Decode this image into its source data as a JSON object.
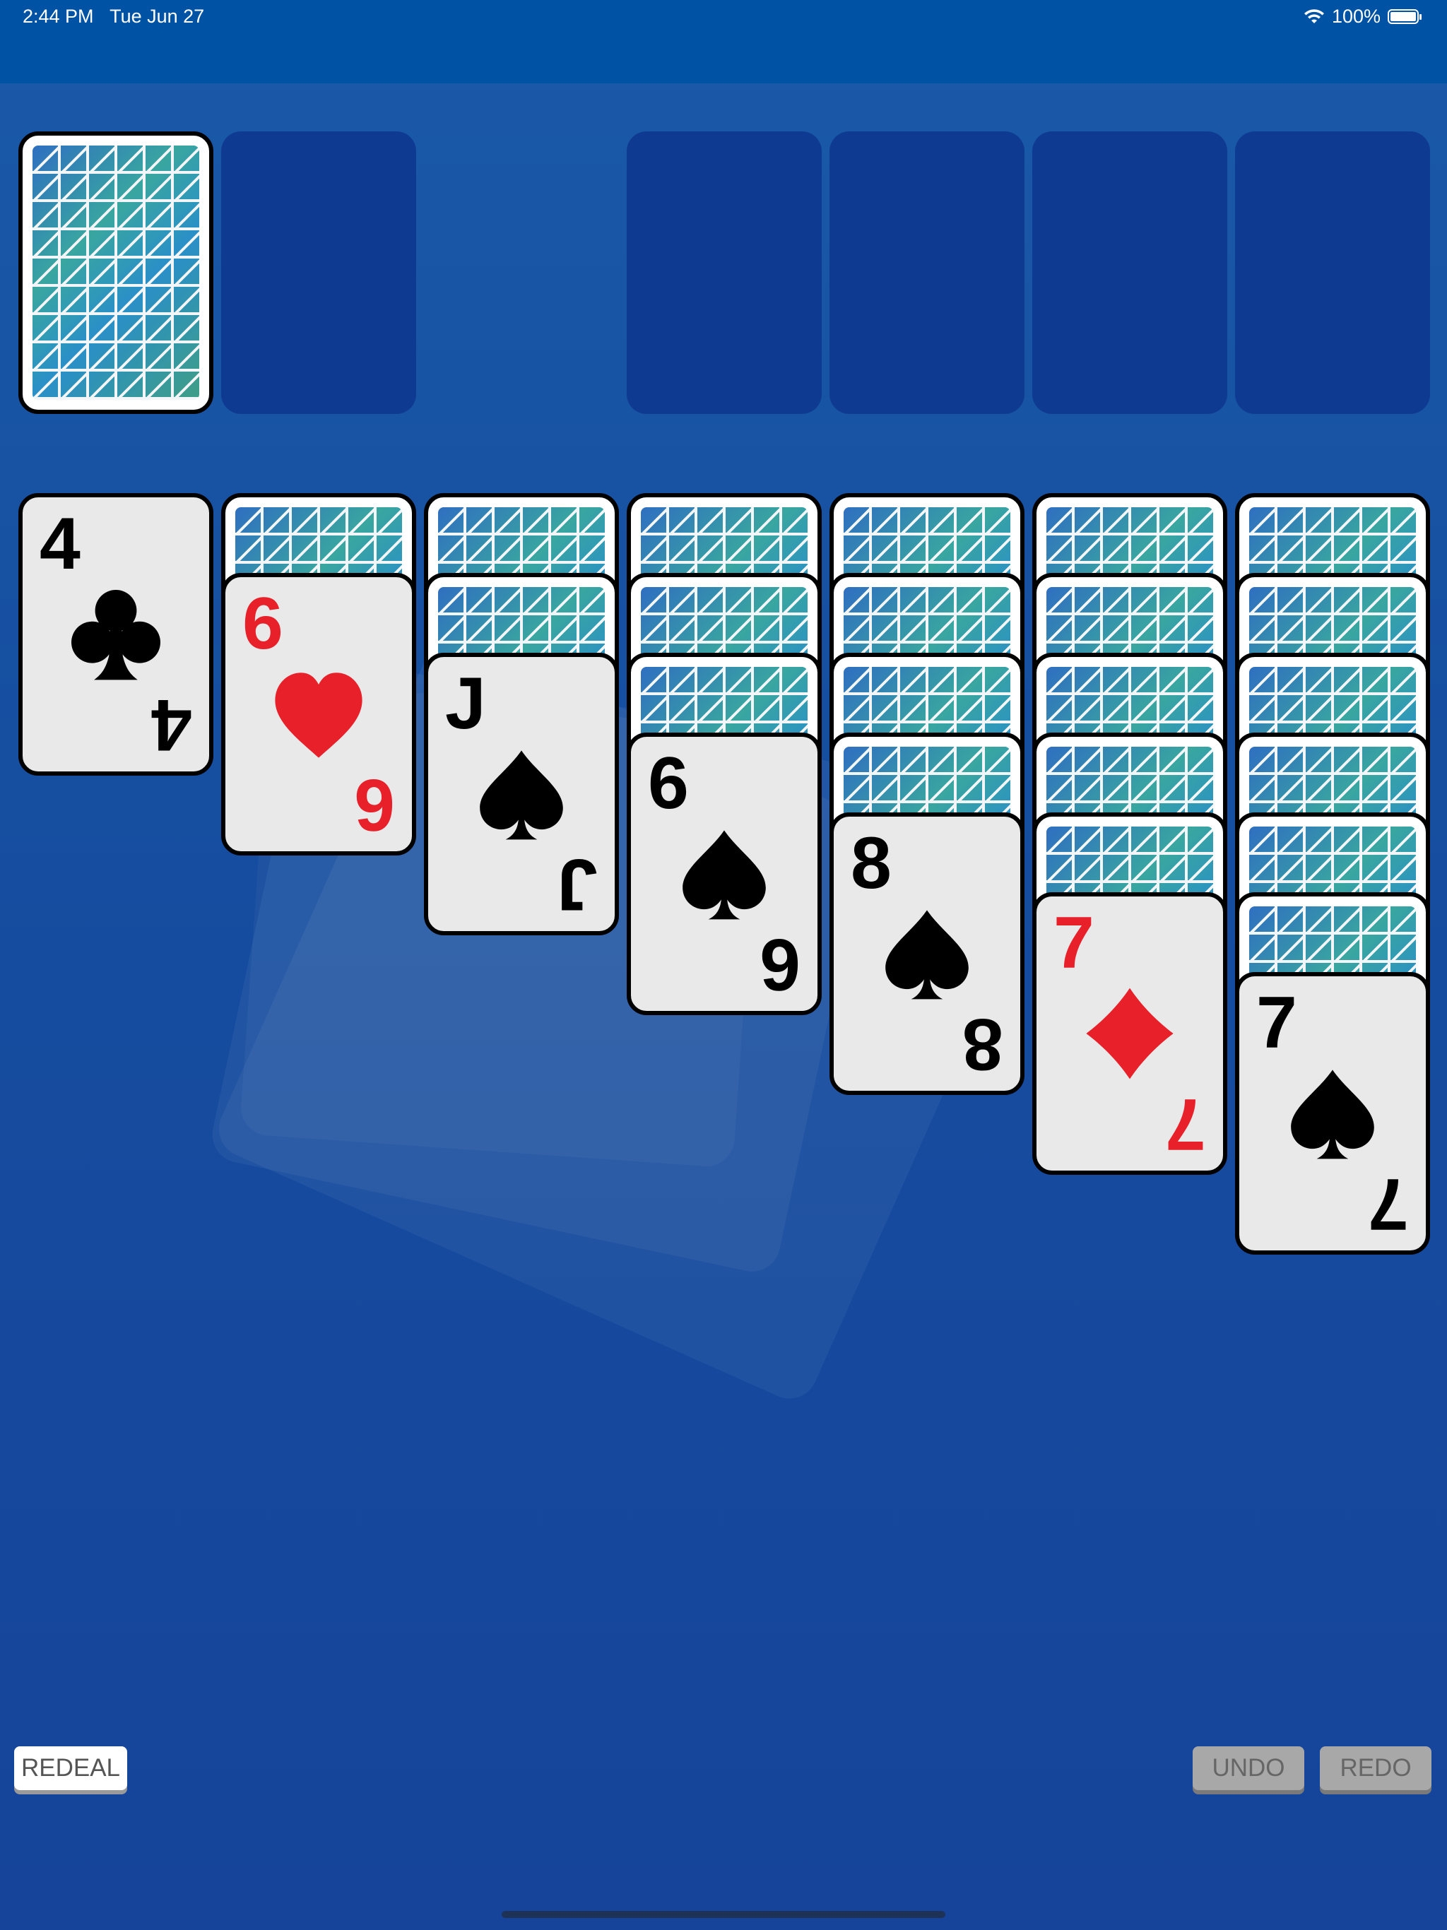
{
  "status_bar": {
    "time": "2:44 PM",
    "date": "Tue Jun 27",
    "battery": "100%"
  },
  "colors": {
    "table_blue": "#1a5aa8",
    "red_suit": "#e8202a",
    "black_suit": "#000000",
    "empty_slot": "#0f3a92"
  },
  "stock": {
    "state": "face-down"
  },
  "waste": {
    "state": "empty"
  },
  "foundations": [
    {
      "state": "empty"
    },
    {
      "state": "empty"
    },
    {
      "state": "empty"
    },
    {
      "state": "empty"
    }
  ],
  "tableau": [
    {
      "face_down": 0,
      "top": {
        "rank": "4",
        "suit": "clubs",
        "color": "black"
      }
    },
    {
      "face_down": 1,
      "top": {
        "rank": "6",
        "suit": "hearts",
        "color": "red"
      }
    },
    {
      "face_down": 2,
      "top": {
        "rank": "J",
        "suit": "spades",
        "color": "black"
      }
    },
    {
      "face_down": 3,
      "top": {
        "rank": "6",
        "suit": "spades",
        "color": "black"
      }
    },
    {
      "face_down": 4,
      "top": {
        "rank": "8",
        "suit": "spades",
        "color": "black"
      }
    },
    {
      "face_down": 5,
      "top": {
        "rank": "7",
        "suit": "diamonds",
        "color": "red"
      }
    },
    {
      "face_down": 6,
      "top": {
        "rank": "7",
        "suit": "spades",
        "color": "black"
      }
    }
  ],
  "buttons": {
    "redeal": "REDEAL",
    "undo": "UNDO",
    "redo": "REDO"
  }
}
